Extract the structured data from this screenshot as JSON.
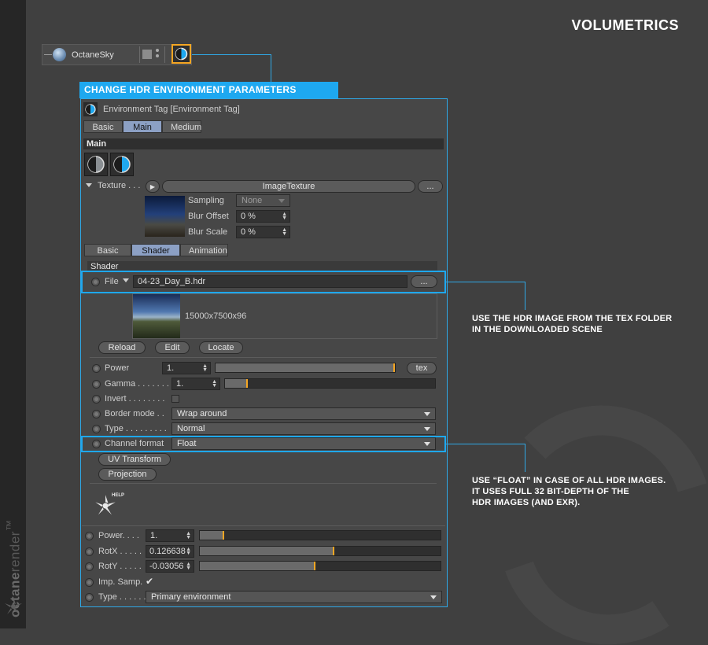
{
  "page_title": "VOLUMETRICS",
  "brand": {
    "name_bold": "octane",
    "name_light": "render",
    "mark": "™"
  },
  "object": {
    "name": "OctaneSky"
  },
  "banner": "CHANGE HDR ENVIRONMENT PARAMETERS",
  "panel_title": "Environment Tag [Environment Tag]",
  "top_tabs": [
    "Basic",
    "Main",
    "Medium"
  ],
  "top_tab_active": "Main",
  "main_section": "Main",
  "texture": {
    "label": "Texture . . .",
    "value": "ImageTexture",
    "more": "..."
  },
  "sampling": {
    "label": "Sampling",
    "value": "None"
  },
  "blur_offset": {
    "label": "Blur Offset",
    "value": "0 %"
  },
  "blur_scale": {
    "label": "Blur Scale",
    "value": "0 %"
  },
  "shader_tabs": [
    "Basic",
    "Shader",
    "Animation"
  ],
  "shader_tab_active": "Shader",
  "shader_section": "Shader",
  "file": {
    "label": "File",
    "value": "04-23_Day_B.hdr",
    "more": "..."
  },
  "image_size": "15000x7500x96",
  "file_buttons": [
    "Reload",
    "Edit",
    "Locate"
  ],
  "power": {
    "label": "Power",
    "value": "1.",
    "button": "tex",
    "level": 1.0
  },
  "gamma": {
    "label": "Gamma . . . . . . .",
    "value": "1.",
    "level": 0.11
  },
  "invert": {
    "label": "Invert . . . . . . . ."
  },
  "border_mode": {
    "label": "Border mode . .",
    "value": "Wrap around"
  },
  "type1": {
    "label": "Type . . . . . . . . .",
    "value": "Normal"
  },
  "channel_format": {
    "label": "Channel format",
    "value": "Float"
  },
  "buttons": [
    "UV Transform",
    "Projection"
  ],
  "help_label": "HELP",
  "env_power": {
    "label": "Power. . . .",
    "value": "1.",
    "level": 0.1
  },
  "rotx": {
    "label": "RotX . . . . .",
    "value": "0.126638",
    "level": 0.56
  },
  "roty": {
    "label": "RotY . . . . .",
    "value": "-0.03056",
    "level": 0.48
  },
  "imp_samp": {
    "label": "Imp. Samp.",
    "checked": "✔"
  },
  "type2": {
    "label": "Type . . . . . .",
    "value": "Primary environment"
  },
  "notes": {
    "hdr_line1": "USE THE HDR IMAGE FROM THE TEX FOLDER",
    "hdr_line2": "IN THE DOWNLOADED SCENE",
    "float_line1": "USE “FLOAT” IN CASE OF ALL HDR IMAGES.",
    "float_line2": "IT USES FULL 32 BIT-DEPTH OF THE",
    "float_line3": "HDR IMAGES (AND EXR)."
  },
  "colors": {
    "accent": "#1ea8f0",
    "slider_knob": "#f5a623",
    "tab_active": "#8ca0c4"
  }
}
